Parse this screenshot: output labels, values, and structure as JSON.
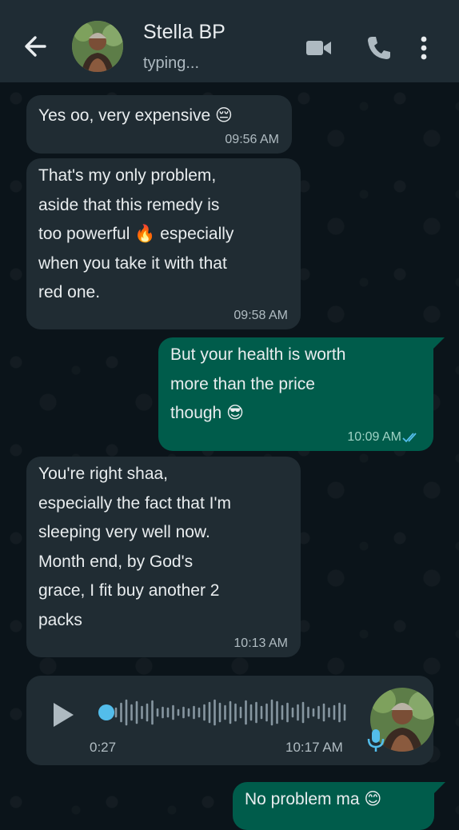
{
  "header": {
    "contact_name": "Stella BP",
    "status": "typing...",
    "icons": [
      "back-arrow-icon",
      "video-call-icon",
      "voice-call-icon",
      "more-options-icon"
    ]
  },
  "messages": [
    {
      "direction": "in",
      "text": "Yes oo, very expensive 😔",
      "time": "09:56 AM"
    },
    {
      "direction": "in",
      "text": "That's my only problem,\naside that this remedy is\ntoo powerful 🔥 especially\nwhen you take it with that\nred one.",
      "time": "09:58 AM"
    },
    {
      "direction": "out",
      "text": "But your health is worth\nmore than the price\nthough 😎",
      "time": "10:09 AM"
    },
    {
      "direction": "in",
      "text": "You're right shaa,\nespecially the fact that I'm\nsleeping very well now.\nMonth end, by God's\ngrace, I fit buy another 2\npacks",
      "time": "10:13 AM"
    },
    {
      "direction": "out",
      "text": "No problem ma 😊",
      "time": ""
    }
  ],
  "voice_note": {
    "duration": "0:27",
    "time": "10:17 AM"
  },
  "colors": {
    "header": "#1f2c34",
    "incoming": "#202c33",
    "outgoing": "#005c4b",
    "accent": "#53bdeb"
  }
}
